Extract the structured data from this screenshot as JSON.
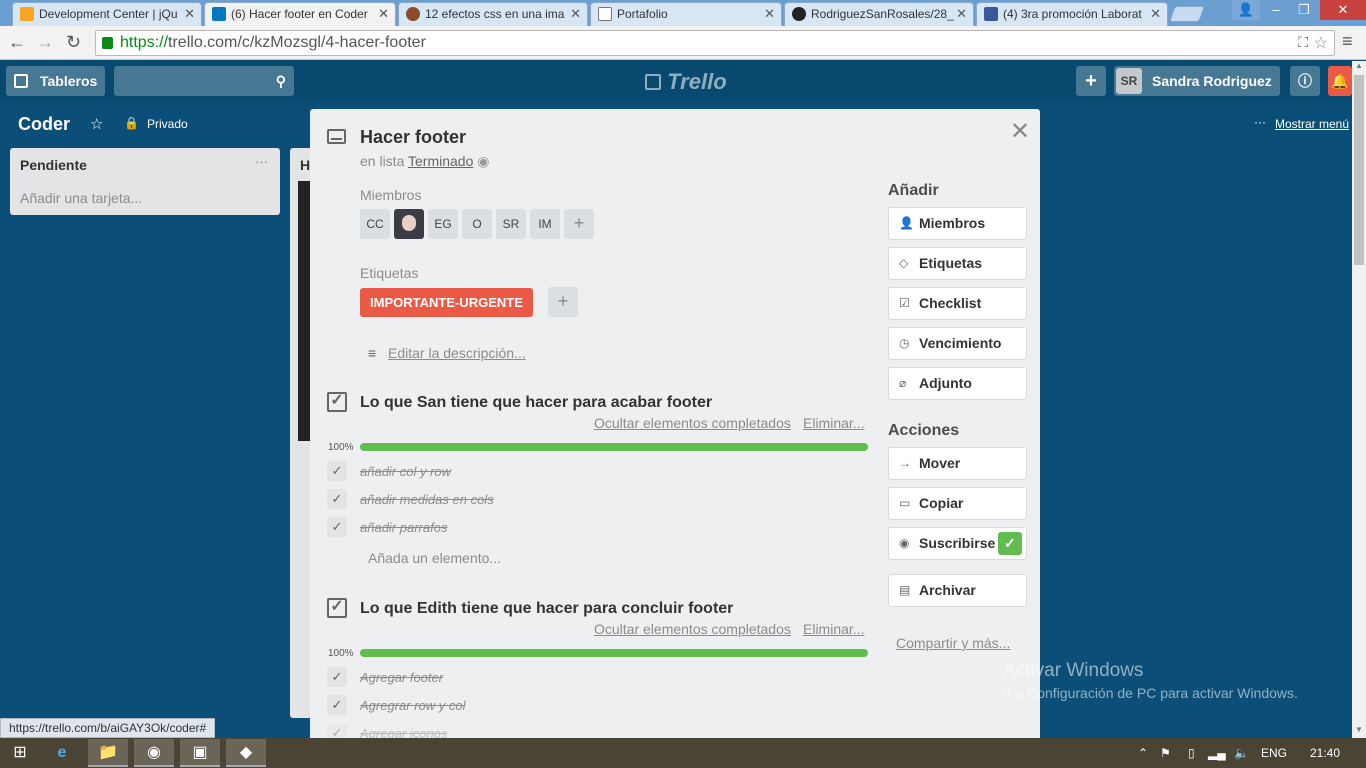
{
  "browser": {
    "tabs": [
      {
        "label": "Development Center | jQu",
        "icon_color": "#f5a623"
      },
      {
        "label": "(6) Hacer footer en Coder",
        "icon_color": "#0079bf",
        "active": true
      },
      {
        "label": "12 efectos css en una ima",
        "icon_color": "#8b4a2b"
      },
      {
        "label": "Portafolio",
        "icon_color": "#ffffff"
      },
      {
        "label": "RodriguezSanRosales/28_",
        "icon_color": "#222222"
      },
      {
        "label": "(4) 3ra promoción Laborat",
        "icon_color": "#3b5998"
      }
    ],
    "url_scheme": "https://",
    "url_rest": "trello.com/c/kzMozsgl/4-hacer-footer",
    "status_url": "https://trello.com/b/aiGAY3Ok/coder#"
  },
  "trello_header": {
    "boards_label": "Tableros",
    "logo": "Trello",
    "user_initials": "SR",
    "user_name": "Sandra Rodriguez"
  },
  "board": {
    "title": "Coder",
    "visibility": "Privado",
    "show_menu": "Mostrar menú",
    "list_title": "Pendiente",
    "add_card": "Añadir una tarjeta...",
    "list2_initial": "H"
  },
  "card": {
    "title": "Hacer footer",
    "in_list_prefix": "en lista",
    "list_name": "Terminado",
    "members_label": "Miembros",
    "members": [
      "CC",
      "",
      "EG",
      "O",
      "SR",
      "IM"
    ],
    "labels_label": "Etiquetas",
    "label": "IMPORTANTE-URGENTE",
    "edit_description": "Editar la descripción...",
    "checklists": [
      {
        "title": "Lo que San tiene que hacer para acabar footer",
        "hide_label": "Ocultar elementos completados",
        "delete_label": "Eliminar...",
        "progress_text": "100%",
        "progress": 1.0,
        "items": [
          "añadir col y row",
          "añadir medidas en cols",
          "añadir parrafos"
        ],
        "add_item": "Añada un elemento..."
      },
      {
        "title": "Lo que Edith tiene que hacer para concluir footer",
        "hide_label": "Ocultar elementos completados",
        "delete_label": "Eliminar...",
        "progress_text": "100%",
        "progress": 1.0,
        "items": [
          "Agregar footer",
          "Agregrar row y col",
          "Agregar iconos"
        ]
      }
    ]
  },
  "sidebar": {
    "add_heading": "Añadir",
    "add_buttons": [
      "Miembros",
      "Etiquetas",
      "Checklist",
      "Vencimiento",
      "Adjunto"
    ],
    "actions_heading": "Acciones",
    "action_buttons": [
      "Mover",
      "Copiar",
      "Suscribirse",
      "Archivar"
    ],
    "share": "Compartir y más..."
  },
  "watermark": {
    "line1": "Activar Windows",
    "line2": "Ir a Configuración de PC para activar Windows."
  },
  "taskbar": {
    "lang": "ENG",
    "time": "21:40"
  }
}
